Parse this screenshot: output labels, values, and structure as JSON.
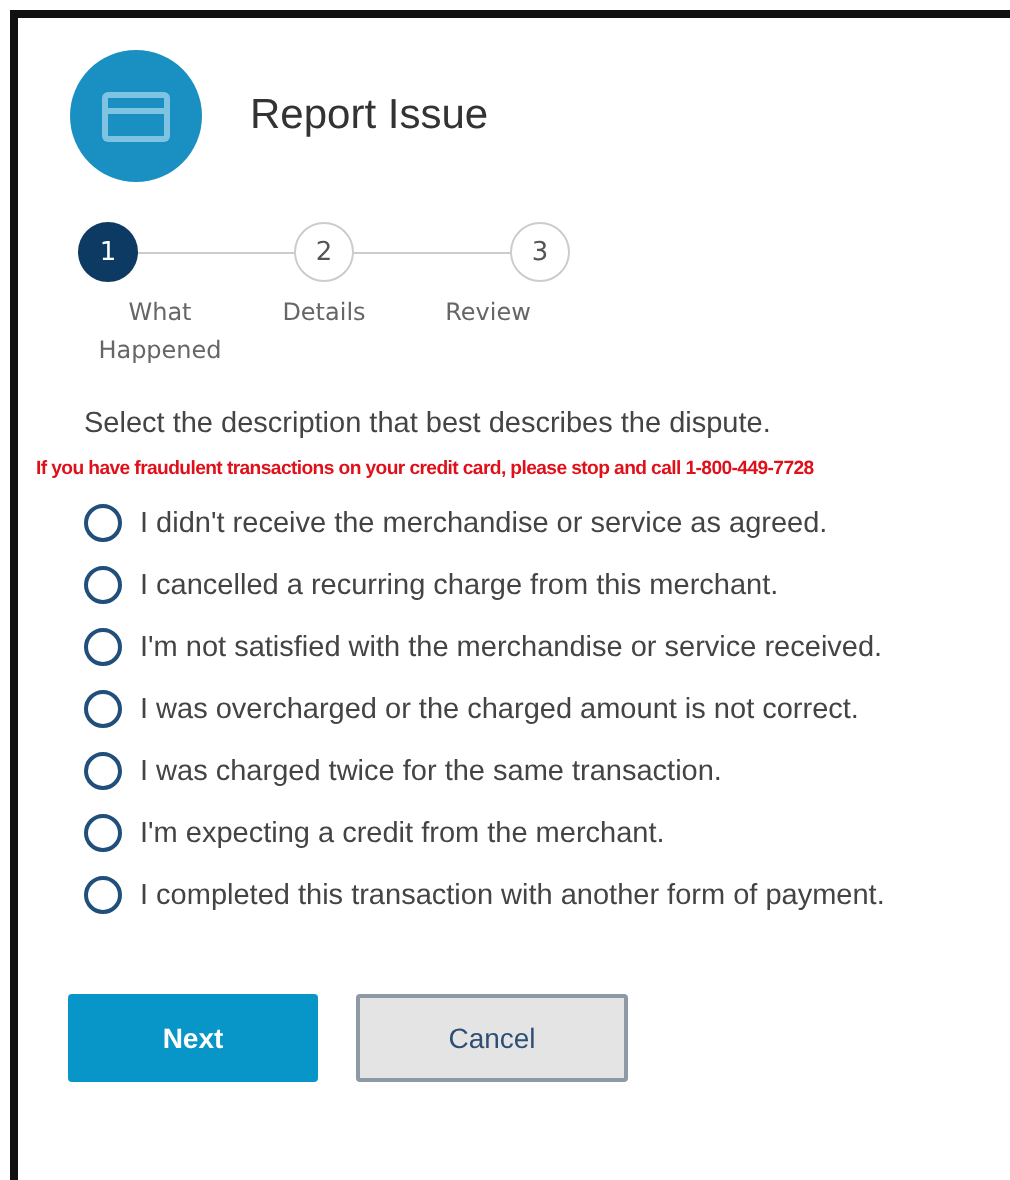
{
  "header": {
    "title": "Report Issue"
  },
  "steps": [
    {
      "number": "1",
      "label": "What Happened",
      "selected": true
    },
    {
      "number": "2",
      "label": "Details",
      "selected": false
    },
    {
      "number": "3",
      "label": "Review",
      "selected": false
    }
  ],
  "prompt": "Select the description that best describes the dispute.",
  "warning": "If you have fraudulent transactions on your credit card, please stop and call 1-800-449-7728",
  "options": [
    {
      "label": "I didn't receive the merchandise or service as agreed.",
      "selected": false
    },
    {
      "label": "I cancelled a recurring charge from this merchant.",
      "selected": false
    },
    {
      "label": "I'm not satisfied with the merchandise or service received.",
      "selected": false
    },
    {
      "label": "I was overcharged or the charged amount is not correct.",
      "selected": false
    },
    {
      "label": "I was charged twice for the same transaction.",
      "selected": false
    },
    {
      "label": "I'm expecting a credit from the merchant.",
      "selected": false
    },
    {
      "label": "I completed this transaction with another form of payment.",
      "selected": false
    }
  ],
  "buttons": [
    {
      "label": "Next",
      "kind": "primary"
    },
    {
      "label": "Cancel",
      "kind": "secondary"
    }
  ]
}
